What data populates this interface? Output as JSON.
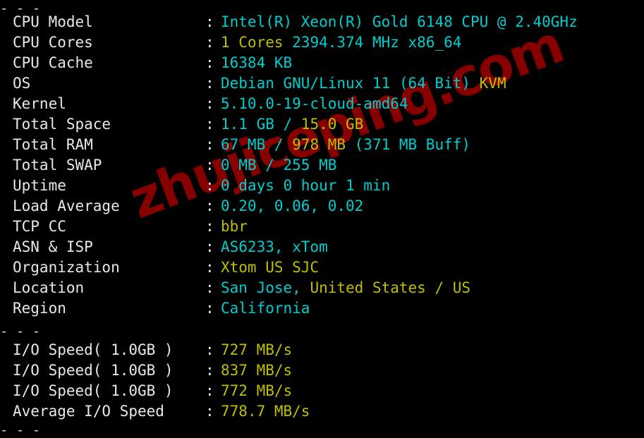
{
  "terminal": {
    "background": "#000000",
    "colors": {
      "label": "#E8E8E8",
      "cyan": "#00CDCD",
      "yellow": "#BFBF00",
      "divider": "#D8D8D8",
      "watermark": "#8B0000"
    },
    "divider_char": "-",
    "divider_top": "------------------------------------------------------------------------",
    "divider_middle": "------------------------------------------------------------------------",
    "divider_bottom": "------------------------------------------------------------------------",
    "separator": ":"
  },
  "watermark": {
    "text": "zhujiceping.com"
  },
  "system_info": {
    "rows": [
      {
        "label": "CPU Model",
        "value": "Intel(R) Xeon(R) Gold 6148 CPU @ 2.40GHz"
      },
      {
        "label": "CPU Cores",
        "value": "1 Cores 2394.374 MHz x86_64"
      },
      {
        "label": "CPU Cache",
        "value": "16384 KB"
      },
      {
        "label": "OS",
        "value": "Debian GNU/Linux 11 (64 Bit) KVM"
      },
      {
        "label": "Kernel",
        "value": "5.10.0-19-cloud-amd64"
      },
      {
        "label": "Total Space",
        "value": "1.1 GB / 15.0 GB"
      },
      {
        "label": "Total RAM",
        "value": "67 MB / 978 MB (371 MB Buff)"
      },
      {
        "label": "Total SWAP",
        "value": "0 MB / 255 MB"
      },
      {
        "label": "Uptime",
        "value": "0 days 0 hour 1 min"
      },
      {
        "label": "Load Average",
        "value": "0.20, 0.06, 0.02"
      },
      {
        "label": "TCP CC",
        "value": "bbr"
      },
      {
        "label": "ASN & ISP",
        "value": "AS6233, xTom"
      },
      {
        "label": "Organization",
        "value": "Xtom US SJC"
      },
      {
        "label": "Location",
        "value": "San Jose, United States / US"
      },
      {
        "label": "Region",
        "value": "California"
      }
    ]
  },
  "io_results": {
    "rows": [
      {
        "label": "I/O Speed( 1.0GB )",
        "value": "727 MB/s"
      },
      {
        "label": "I/O Speed( 1.0GB )",
        "value": "837 MB/s"
      },
      {
        "label": "I/O Speed( 1.0GB )",
        "value": "772 MB/s"
      },
      {
        "label": "Average I/O Speed",
        "value": "778.7 MB/s"
      }
    ]
  },
  "value_segments": {
    "cpu_model": [
      {
        "t": "Intel(R) Xeon(R) Gold 6148 CPU @ 2.40GHz",
        "c": "cy"
      }
    ],
    "cpu_cores": [
      {
        "t": "1 Cores",
        "c": "ye"
      },
      {
        "t": " 2394.374 MHz x86_64",
        "c": "cy"
      }
    ],
    "cpu_cache": [
      {
        "t": "16384 KB",
        "c": "cy"
      }
    ],
    "os": [
      {
        "t": "Debian GNU/Linux 11 (64 Bit) ",
        "c": "cy"
      },
      {
        "t": "KVM",
        "c": "ye"
      }
    ],
    "kernel": [
      {
        "t": "5.10.0-19-cloud-amd64",
        "c": "cy"
      }
    ],
    "total_space": [
      {
        "t": "1.1 GB / ",
        "c": "cy"
      },
      {
        "t": "15.0 GB",
        "c": "ye"
      }
    ],
    "total_ram": [
      {
        "t": "67 MB / ",
        "c": "cy"
      },
      {
        "t": "978 MB",
        "c": "ye"
      },
      {
        "t": " (371 MB Buff)",
        "c": "cy"
      }
    ],
    "total_swap": [
      {
        "t": "0 MB / 255 MB",
        "c": "cy"
      }
    ],
    "uptime": [
      {
        "t": "0 days 0 hour 1 min",
        "c": "cy"
      }
    ],
    "load_average": [
      {
        "t": "0.20, 0.06, 0.02",
        "c": "cy"
      }
    ],
    "tcp_cc": [
      {
        "t": "bbr",
        "c": "ye"
      }
    ],
    "asn_isp": [
      {
        "t": "AS6233, xTom",
        "c": "cy"
      }
    ],
    "organization": [
      {
        "t": "Xtom US SJC",
        "c": "ye"
      }
    ],
    "location": [
      {
        "t": "San Jose, ",
        "c": "cy"
      },
      {
        "t": "United States / US",
        "c": "ye"
      }
    ],
    "region": [
      {
        "t": "California",
        "c": "cy"
      }
    ],
    "io_1": [
      {
        "t": "727 MB/s",
        "c": "ye"
      }
    ],
    "io_2": [
      {
        "t": "837 MB/s",
        "c": "ye"
      }
    ],
    "io_3": [
      {
        "t": "772 MB/s",
        "c": "ye"
      }
    ],
    "io_avg": [
      {
        "t": "778.7 MB/s",
        "c": "ye"
      }
    ]
  }
}
